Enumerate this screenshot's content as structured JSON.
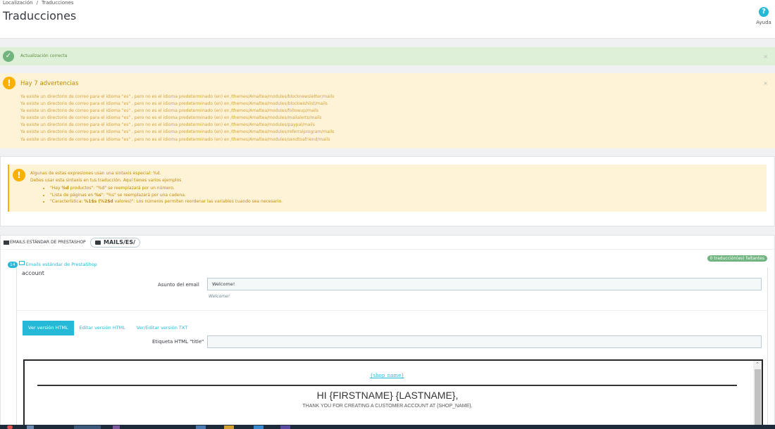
{
  "header": {
    "breadcrumb": [
      "Localización",
      "Traducciones"
    ],
    "title": "Traducciones",
    "help_label": "Ayuda",
    "help_icon": "?"
  },
  "success_alert": {
    "message": "Actualización correcta",
    "close": "×"
  },
  "warning_alert": {
    "title": "Hay 7 advertencias",
    "close": "×",
    "items": [
      "Ya existe un directorio de correo para el idioma \"es\" , pero no es el idioma predeterminado (en) en /themes/Amaltea/modules/blocknewsletter/mails",
      "Ya existe un directorio de correo para el idioma \"es\" , pero no es el idioma predeterminado (en) en /themes/Amaltea/modules/blockwishlist/mails",
      "Ya existe un directorio de correo para el idioma \"es\" , pero no es el idioma predeterminado (en) en /themes/Amaltea/modules/followup/mails",
      "Ya existe un directorio de correo para el idioma \"es\" , pero no es el idioma predeterminado (en) en /themes/Amaltea/modules/mailalerts/mails",
      "Ya existe un directorio de correo para el idioma \"es\" , pero no es el idioma predeterminado (en) en /themes/Amaltea/modules/paypal/mails",
      "Ya existe un directorio de correo para el idioma \"es\" , pero no es el idioma predeterminado (en) en /themes/Amaltea/modules/referralprogram/mails",
      "Ya existe un directorio de correo para el idioma \"es\" , pero no es el idioma predeterminado (en) en /themes/Amaltea/modules/sendtoafriend/mails"
    ]
  },
  "syntax_note": {
    "line1": "Algunas de estas expresiones usan una sintaxis especial: %d.",
    "line2": "Debes usar esta sintaxis en tus traducción. Aquí tienes varios ejemplos",
    "examples": [
      {
        "bold": "",
        "text_before": "\"Hay ",
        "code": "%d",
        "text_after": " productos\": \"%d\" se reemplazará por un número."
      },
      {
        "bold": "",
        "text_before": "\"Lista de páginas en ",
        "code": "%s",
        "text_after": "\": \"%s\" se reemplazará por una cadena."
      },
      {
        "bold": "",
        "text_before": "\"Característica: ",
        "code": "%1$s (%2$d",
        "text_after": " valores)\": Los números permiten reordenar las variables cuando sea necesario."
      }
    ]
  },
  "emails_panel": {
    "heading": "EMAILS ESTÁNDAR DE PRESTASHOP",
    "folder_pill": "MAILS/ES/",
    "count": "14",
    "section_link": "Emails estándar de PrestaShop",
    "missing_badge": "0 traducción(es) faltantes",
    "template_name": "account",
    "subject_label": "Asunto del email",
    "subject_value": "Welcome!",
    "subject_hint": "Welcome!",
    "tabs": [
      "Ver versión HTML",
      "Editar versión HTML",
      "Ver/Editar versión TXT"
    ],
    "active_tab": 0,
    "title_label": "Etiqueta HTML \"title\"",
    "title_value": "",
    "preview": {
      "shop_name": "{shop_name}",
      "greeting": "HI {FIRSTNAME} {LASTNAME},",
      "thanks": "THANK YOU FOR CREATING A CUSTOMER ACCOUNT AT {SHOP_NAME}."
    }
  },
  "colors": {
    "accent": "#25b9d7",
    "success": "#70b580",
    "warning": "#fab000"
  }
}
